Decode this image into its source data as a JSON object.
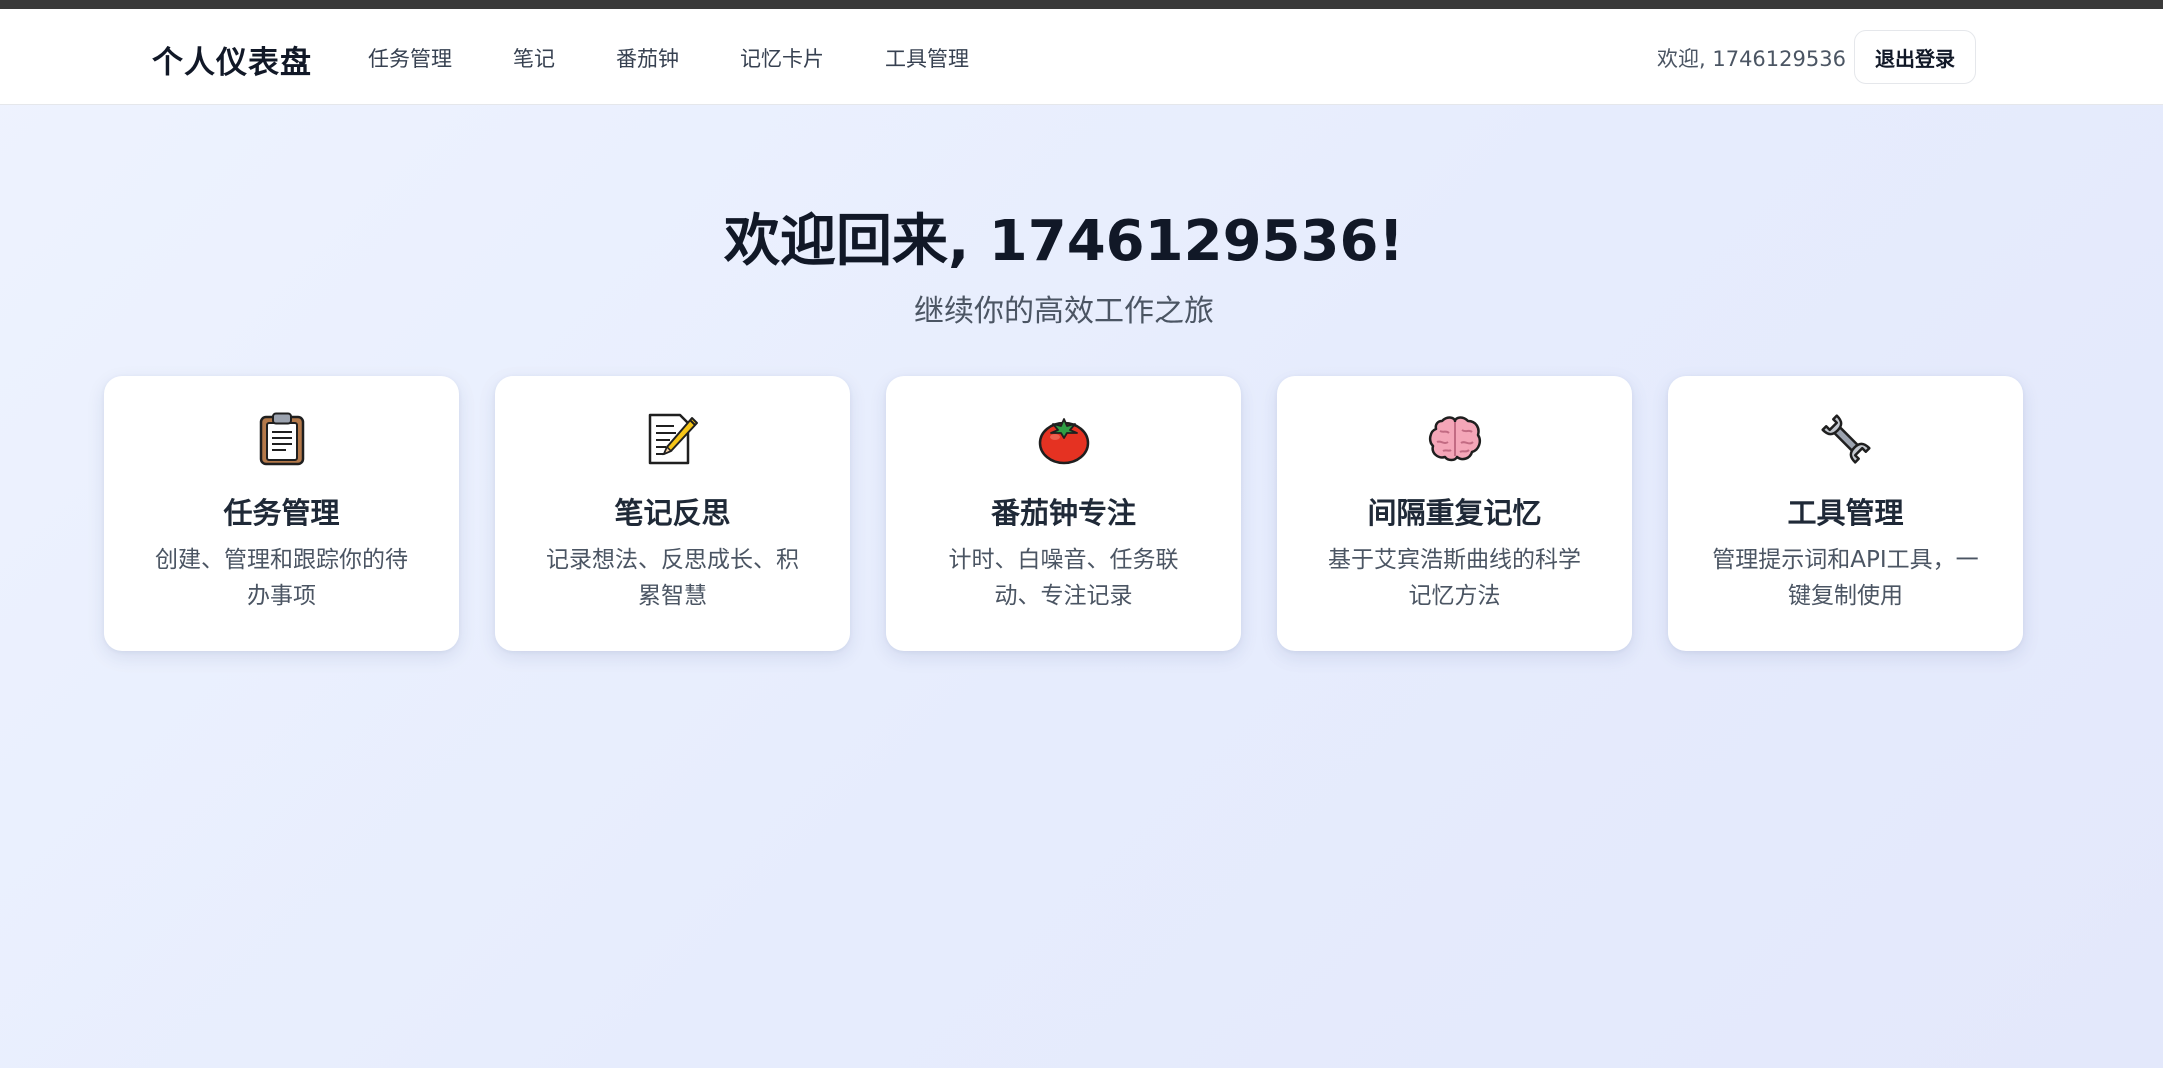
{
  "navbar": {
    "brand": "个人仪表盘",
    "links": [
      "任务管理",
      "笔记",
      "番茄钟",
      "记忆卡片",
      "工具管理"
    ],
    "welcome": "欢迎, 1746129536",
    "logout_label": "退出登录"
  },
  "hero": {
    "title": "欢迎回来, 1746129536!",
    "subtitle": "继续你的高效工作之旅"
  },
  "cards": [
    {
      "icon": "clipboard-icon",
      "title": "任务管理",
      "desc": "创建、管理和跟踪你的待办事项"
    },
    {
      "icon": "memo-icon",
      "title": "笔记反思",
      "desc": "记录想法、反思成长、积累智慧"
    },
    {
      "icon": "tomato-icon",
      "title": "番茄钟专注",
      "desc": "计时、白噪音、任务联动、专注记录"
    },
    {
      "icon": "brain-icon",
      "title": "间隔重复记忆",
      "desc": "基于艾宾浩斯曲线的科学记忆方法"
    },
    {
      "icon": "wrench-icon",
      "title": "工具管理",
      "desc": "管理提示词和API工具，一键复制使用"
    }
  ],
  "colors": {
    "background": "#e8eefd",
    "topstrip": "#3a3a3a",
    "text_primary": "#111827",
    "text_secondary": "#4b5563",
    "card_bg": "#ffffff"
  }
}
